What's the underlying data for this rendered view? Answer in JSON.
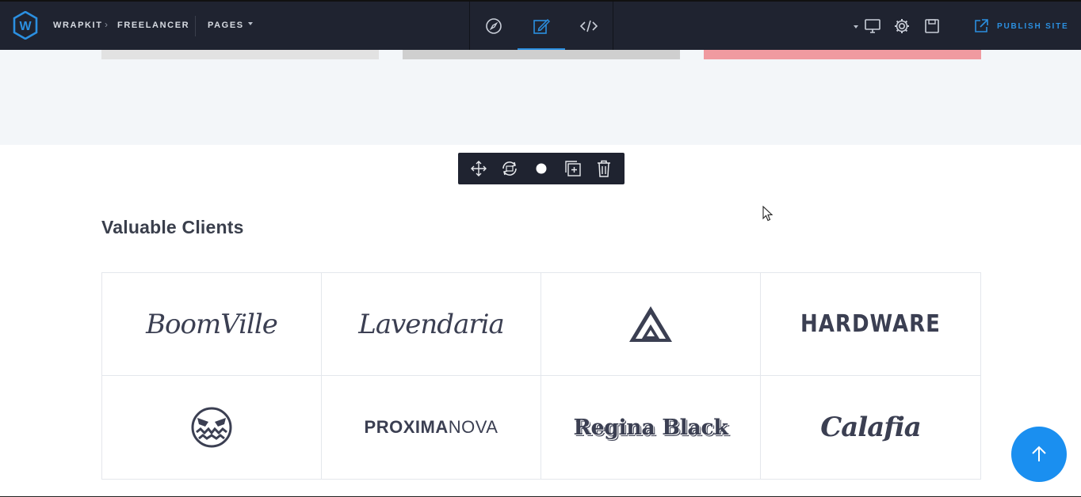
{
  "topbar": {
    "logo_letter": "W",
    "breadcrumb": [
      "WRAPKIT",
      "FREELANCER"
    ],
    "breadcrumb_separator": "›",
    "pages_label": "PAGES",
    "modes": [
      "compass-icon",
      "edit-icon",
      "code-icon"
    ],
    "active_mode": "edit-icon",
    "tools": [
      "device-dropdown-caret",
      "desktop-icon",
      "gear-icon",
      "save-icon"
    ],
    "publish_label": "PUBLISH SITE"
  },
  "section_toolbar": {
    "buttons": [
      "move-icon",
      "swap-section-icon",
      "background-dot-icon",
      "duplicate-icon",
      "trash-icon"
    ]
  },
  "clients": {
    "title": "Valuable Clients",
    "logos": [
      "BoomVille",
      "Lavendaria",
      "triangle-mark-logo",
      "HARDWARE",
      "monster-face-logo",
      "PROXIMANOVA",
      "Regina Black",
      "Calafia"
    ],
    "proxima_bold": "PROXIMA",
    "proxima_light": "NOVA"
  },
  "colors": {
    "topbar_bg": "#1f2330",
    "accent": "#2b8fe0",
    "scroll_top_button": "#1a8ff0",
    "text_dark": "#3a3f4c"
  },
  "scroll_top": {
    "icon": "arrow-up-icon"
  }
}
